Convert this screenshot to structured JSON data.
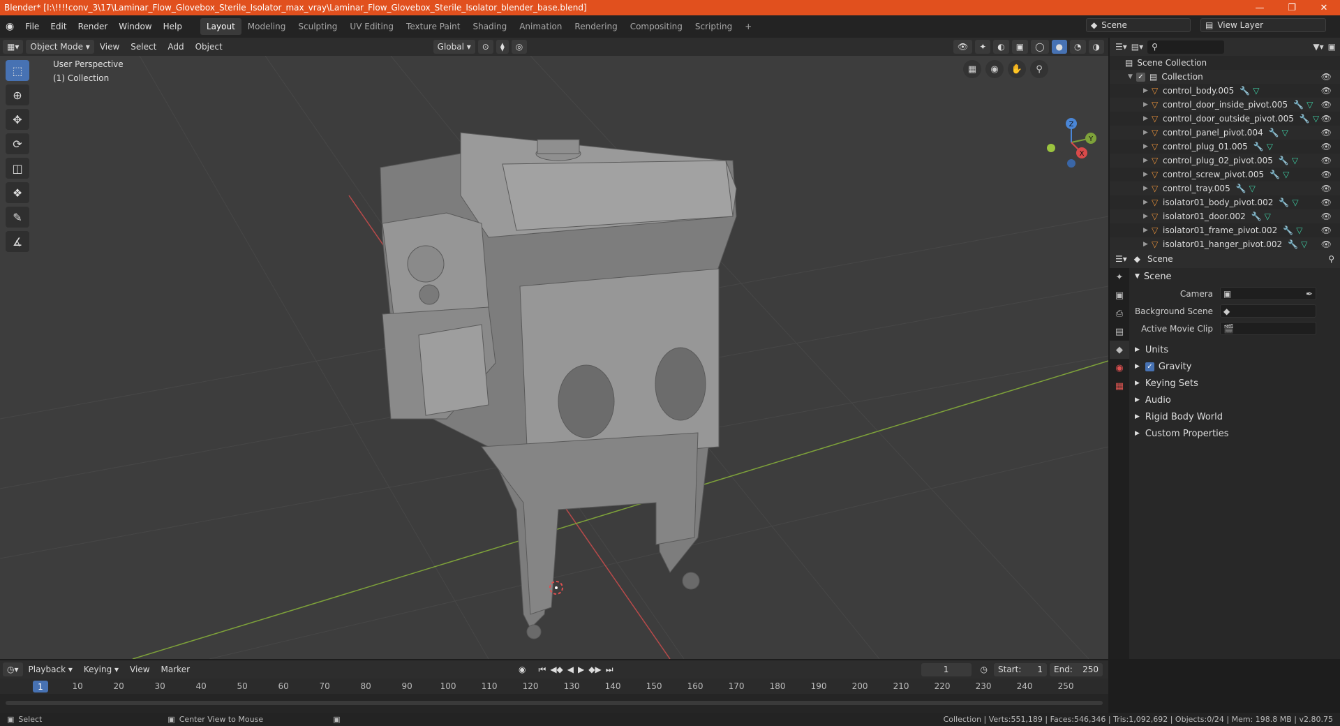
{
  "titlebar": {
    "title": "Blender* [I:\\!!!!conv_3\\17\\Laminar_Flow_Glovebox_Sterile_Isolator_max_vray\\Laminar_Flow_Glovebox_Sterile_Isolator_blender_base.blend]",
    "accent": "#e1501e"
  },
  "menu": [
    "File",
    "Edit",
    "Render",
    "Window",
    "Help"
  ],
  "workspaces": [
    "Layout",
    "Modeling",
    "Sculpting",
    "UV Editing",
    "Texture Paint",
    "Shading",
    "Animation",
    "Rendering",
    "Compositing",
    "Scripting"
  ],
  "scene_field": "Scene",
  "viewlayer_field": "View Layer",
  "viewport_header": {
    "mode": "Object Mode",
    "menus": [
      "View",
      "Select",
      "Add",
      "Object"
    ],
    "orientation": "Global"
  },
  "viewport": {
    "perspective": "User Perspective",
    "collection": "(1) Collection",
    "gizmo": {
      "x": "X",
      "y": "Y",
      "z": "Z"
    }
  },
  "outliner": {
    "root": "Scene Collection",
    "collection": "Collection",
    "items": [
      "control_body.005",
      "control_door_inside_pivot.005",
      "control_door_outside_pivot.005",
      "control_panel_pivot.004",
      "control_plug_01.005",
      "control_plug_02_pivot.005",
      "control_screw_pivot.005",
      "control_tray.005",
      "isolator01_body_pivot.002",
      "isolator01_door.002",
      "isolator01_frame_pivot.002",
      "isolator01_hanger_pivot.002"
    ]
  },
  "properties": {
    "header": "Scene",
    "panel": "Scene",
    "camera_label": "Camera",
    "bg_label": "Background Scene",
    "clip_label": "Active Movie Clip",
    "subpanels": [
      "Units",
      "Gravity",
      "Keying Sets",
      "Audio",
      "Rigid Body World",
      "Custom Properties"
    ]
  },
  "timeline": {
    "menus": [
      "Playback",
      "Keying",
      "View",
      "Marker"
    ],
    "current": "1",
    "start_label": "Start:",
    "start": "1",
    "end_label": "End:",
    "end": "250",
    "ticks": [
      "10",
      "20",
      "30",
      "40",
      "50",
      "60",
      "70",
      "80",
      "90",
      "100",
      "110",
      "120",
      "130",
      "140",
      "150",
      "160",
      "170",
      "180",
      "190",
      "200",
      "210",
      "220",
      "230",
      "240",
      "250"
    ]
  },
  "status": {
    "left": "Select",
    "middle": "Center View to Mouse",
    "right": "Collection | Verts:551,189 | Faces:546,346 | Tris:1,092,692 | Objects:0/24 | Mem: 198.8 MB | v2.80.75"
  }
}
